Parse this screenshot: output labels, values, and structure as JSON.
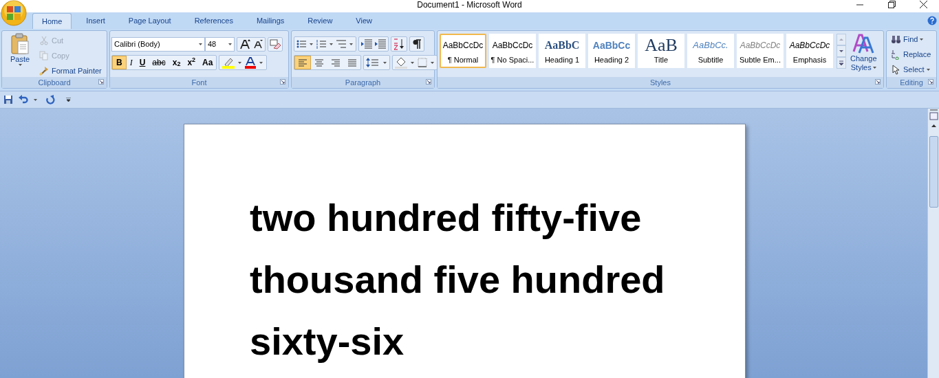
{
  "window": {
    "title": "Document1 - Microsoft Word"
  },
  "tabs": [
    {
      "label": "Home",
      "selected": true
    },
    {
      "label": "Insert",
      "selected": false
    },
    {
      "label": "Page Layout",
      "selected": false
    },
    {
      "label": "References",
      "selected": false
    },
    {
      "label": "Mailings",
      "selected": false
    },
    {
      "label": "Review",
      "selected": false
    },
    {
      "label": "View",
      "selected": false
    }
  ],
  "clipboard": {
    "label": "Clipboard",
    "paste": "Paste",
    "items": [
      {
        "kind": "cut",
        "label": "Cut",
        "disabled": true
      },
      {
        "kind": "copy",
        "label": "Copy",
        "disabled": true
      },
      {
        "kind": "painter",
        "label": "Format Painter",
        "disabled": false
      }
    ]
  },
  "font": {
    "label": "Font",
    "font_name": "Calibri (Body)",
    "font_size": "48",
    "buttons": [
      {
        "label": "B",
        "kind": "bold",
        "selected": true
      },
      {
        "label": "I",
        "kind": "italic",
        "selected": false
      },
      {
        "label": "U",
        "kind": "underline",
        "selected": false
      },
      {
        "label": "abc",
        "kind": "strike",
        "selected": false
      },
      {
        "label": "x$_{2}$",
        "kind": "plain",
        "selected": false
      },
      {
        "label": "x$^{2}$",
        "kind": "plain",
        "selected": false
      },
      {
        "label": "Aa",
        "kind": "plain",
        "selected": false
      }
    ]
  },
  "paragraph": {
    "label": "Paragraph",
    "align": [
      {
        "kind": "left",
        "selected": true
      },
      {
        "kind": "center",
        "selected": false
      },
      {
        "kind": "right",
        "selected": false
      },
      {
        "kind": "justify",
        "selected": false
      }
    ]
  },
  "styles": {
    "label": "Styles",
    "items": [
      {
        "kind": "normal",
        "preview": "AaBbCcDc",
        "name": "¶ Normal",
        "selected": true
      },
      {
        "kind": "normal",
        "preview": "AaBbCcDc",
        "name": "¶ No Spaci...",
        "selected": false
      },
      {
        "kind": "heading1",
        "preview": "AaBbC",
        "name": "Heading 1",
        "selected": false
      },
      {
        "kind": "heading2",
        "preview": "AaBbCc",
        "name": "Heading 2",
        "selected": false
      },
      {
        "kind": "title",
        "preview": "AaB",
        "name": "Title",
        "selected": false
      },
      {
        "kind": "subtitle",
        "preview": "AaBbCc.",
        "name": "Subtitle",
        "selected": false
      },
      {
        "kind": "subtle",
        "preview": "AaBbCcDc",
        "name": "Subtle Em...",
        "selected": false
      },
      {
        "kind": "emphasis",
        "preview": "AaBbCcDc",
        "name": "Emphasis",
        "selected": false
      }
    ],
    "change_styles": [
      "Change",
      "Styles"
    ]
  },
  "editing": {
    "label": "Editing",
    "items": [
      {
        "kind": "find",
        "label": "Find"
      },
      {
        "kind": "replace",
        "label": "Replace"
      },
      {
        "kind": "select",
        "label": "Select"
      }
    ]
  },
  "document": {
    "text": "two hundred fifty-five thousand five hundred sixty-six"
  }
}
